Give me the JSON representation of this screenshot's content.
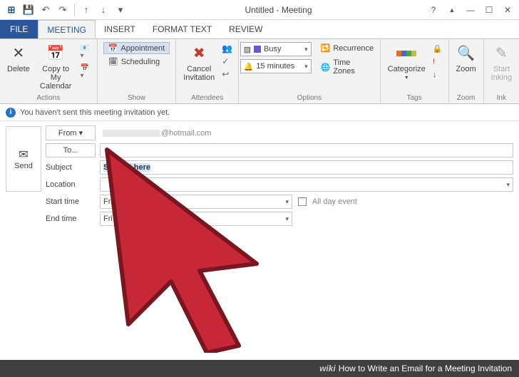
{
  "window": {
    "title": "Untitled - Meeting",
    "help_icon": "?",
    "ribbon_toggle_icon": "▲",
    "minimize_icon": "—",
    "maximize_icon": "☐",
    "close_icon": "✕"
  },
  "qat": {
    "save_icon": "💾",
    "undo_icon": "↶",
    "redo_icon": "↷",
    "down_icon": "▾"
  },
  "tabs": {
    "file": "FILE",
    "meeting": "MEETING",
    "insert": "INSERT",
    "format_text": "FORMAT TEXT",
    "review": "REVIEW"
  },
  "ribbon": {
    "actions": {
      "label": "Actions",
      "delete": "Delete",
      "copy": "Copy to My\nCalendar"
    },
    "show": {
      "label": "Show",
      "appointment": "Appointment",
      "scheduling": "Scheduling"
    },
    "attendees": {
      "label": "Attendees",
      "cancel": "Cancel\nInvitation",
      "address_book_icon": "👥",
      "check_names_icon": "✓",
      "responses_icon": "↩"
    },
    "options": {
      "label": "Options",
      "busy": "Busy",
      "reminder": "15 minutes",
      "recurrence": "Recurrence",
      "time_zones": "Time Zones"
    },
    "tags": {
      "label": "Tags",
      "categorize": "Categorize"
    },
    "zoom": {
      "label": "Zoom",
      "zoom": "Zoom"
    },
    "ink": {
      "label": "Ink",
      "start_inking": "Start\nInking"
    }
  },
  "infobar": {
    "message": "You haven't sent this meeting invitation yet."
  },
  "form": {
    "send": "Send",
    "from_label": "From ▾",
    "from_value": "@hotmail.com",
    "to_label": "To...",
    "to_value": "",
    "subject_label": "Subject",
    "subject_value": "Subject here",
    "location_label": "Location",
    "location_value": "",
    "start_label": "Start time",
    "start_value": "Fri 10/2/2015",
    "end_label": "End time",
    "end_value": "Fri 10/2/2015",
    "all_day": "All day event"
  },
  "footer": {
    "brand": "wiki",
    "text": "How to Write an Email for a Meeting Invitation"
  }
}
